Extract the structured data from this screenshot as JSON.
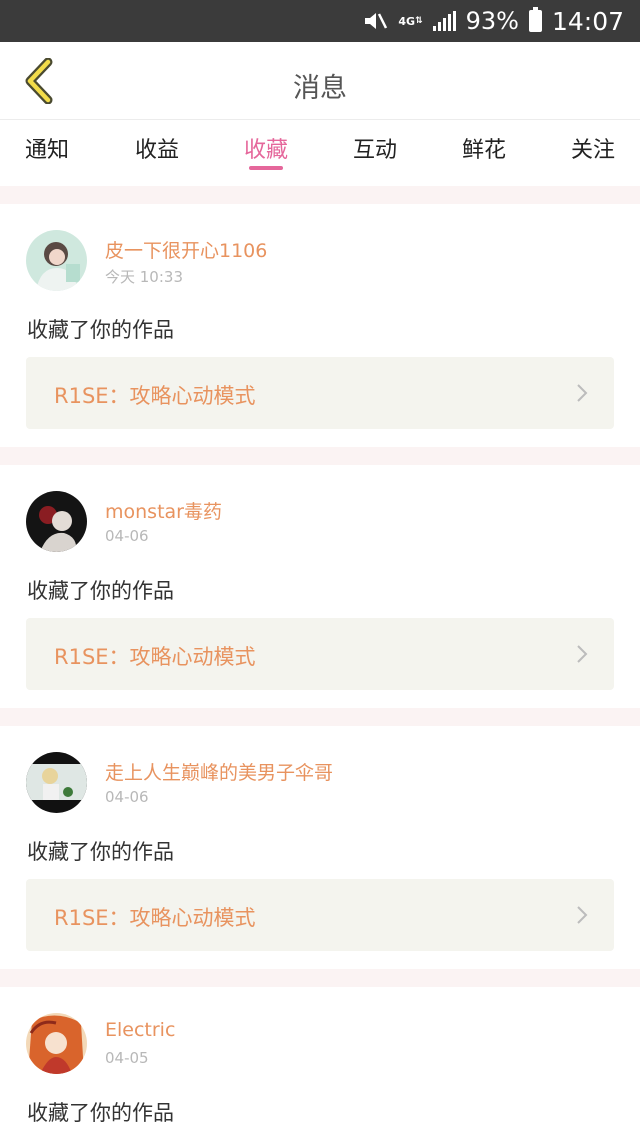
{
  "status_bar": {
    "battery": "93%",
    "time": "14:07",
    "network": "4G"
  },
  "header": {
    "title": "消息"
  },
  "tabs": [
    {
      "label": "通知"
    },
    {
      "label": "收益"
    },
    {
      "label": "收藏",
      "active": true
    },
    {
      "label": "互动"
    },
    {
      "label": "鲜花"
    },
    {
      "label": "关注"
    }
  ],
  "feed": [
    {
      "user": "皮一下很开心1106",
      "time": "今天 10:33",
      "action": "收藏了你的作品",
      "work": "R1SE：攻略心动模式"
    },
    {
      "user": "monstar毒药",
      "time": "04-06",
      "action": "收藏了你的作品",
      "work": "R1SE：攻略心动模式"
    },
    {
      "user": "走上人生巅峰的美男子伞哥",
      "time": "04-06",
      "action": "收藏了你的作品",
      "work": "R1SE：攻略心动模式"
    },
    {
      "user": "Electric",
      "time": "04-05",
      "action": "收藏了你的作品",
      "work": ""
    }
  ],
  "colors": {
    "accent": "#e5679b",
    "name": "#e8935f",
    "card_bg": "#f4f4ee",
    "divider": "#fbf3f3"
  }
}
